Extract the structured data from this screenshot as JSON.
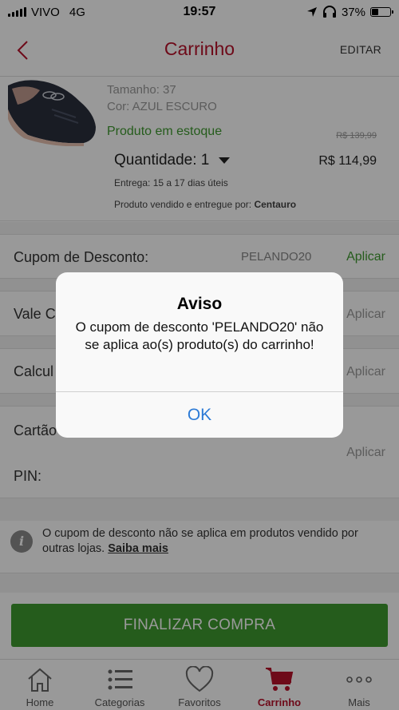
{
  "status_bar": {
    "carrier": "VIVO",
    "network": "4G",
    "time": "19:57",
    "battery": "37%",
    "battery_level": 0.37
  },
  "header": {
    "title": "Carrinho",
    "edit_label": "EDITAR",
    "back_icon": "chevron-left-icon"
  },
  "product": {
    "size": "Tamanho: 37",
    "color": "Cor: AZUL ESCURO",
    "stock": "Produto em estoque",
    "old_price": "R$ 139,99",
    "quantity_label": "Quantidade: 1",
    "price": "R$  114,99",
    "delivery": "Entrega: 15 a 17 dias úteis",
    "seller_prefix": "Produto vendido e entregue por: ",
    "seller_name": "Centauro"
  },
  "discount": {
    "label": "Cupom de Desconto:",
    "value": "PELANDO20",
    "apply": "Aplicar"
  },
  "voucher": {
    "label": "Vale C",
    "apply": "Aplicar"
  },
  "shipping": {
    "label": "Calcul",
    "apply": "Aplicar"
  },
  "gift_card": {
    "label": "Cartão",
    "pin_label": "PIN:",
    "apply": "Aplicar"
  },
  "info": {
    "text": "O cupom de desconto não se aplica em produtos vendido por outras lojas. ",
    "link": "Saiba mais"
  },
  "checkout": {
    "label": "FINALIZAR COMPRA"
  },
  "tabs": [
    {
      "label": "Home",
      "icon": "home-icon"
    },
    {
      "label": "Categorias",
      "icon": "list-icon"
    },
    {
      "label": "Favoritos",
      "icon": "heart-icon"
    },
    {
      "label": "Carrinho",
      "icon": "cart-icon"
    },
    {
      "label": "Mais",
      "icon": "more-icon"
    }
  ],
  "alert": {
    "title": "Aviso",
    "message": "O cupom de desconto 'PELANDO20' não se aplica ao(s) produto(s) do carrinho!",
    "button": "OK"
  },
  "colors": {
    "brand_red": "#b7122b",
    "green": "#3f9a2f",
    "ios_blue": "#2d7bd6"
  }
}
